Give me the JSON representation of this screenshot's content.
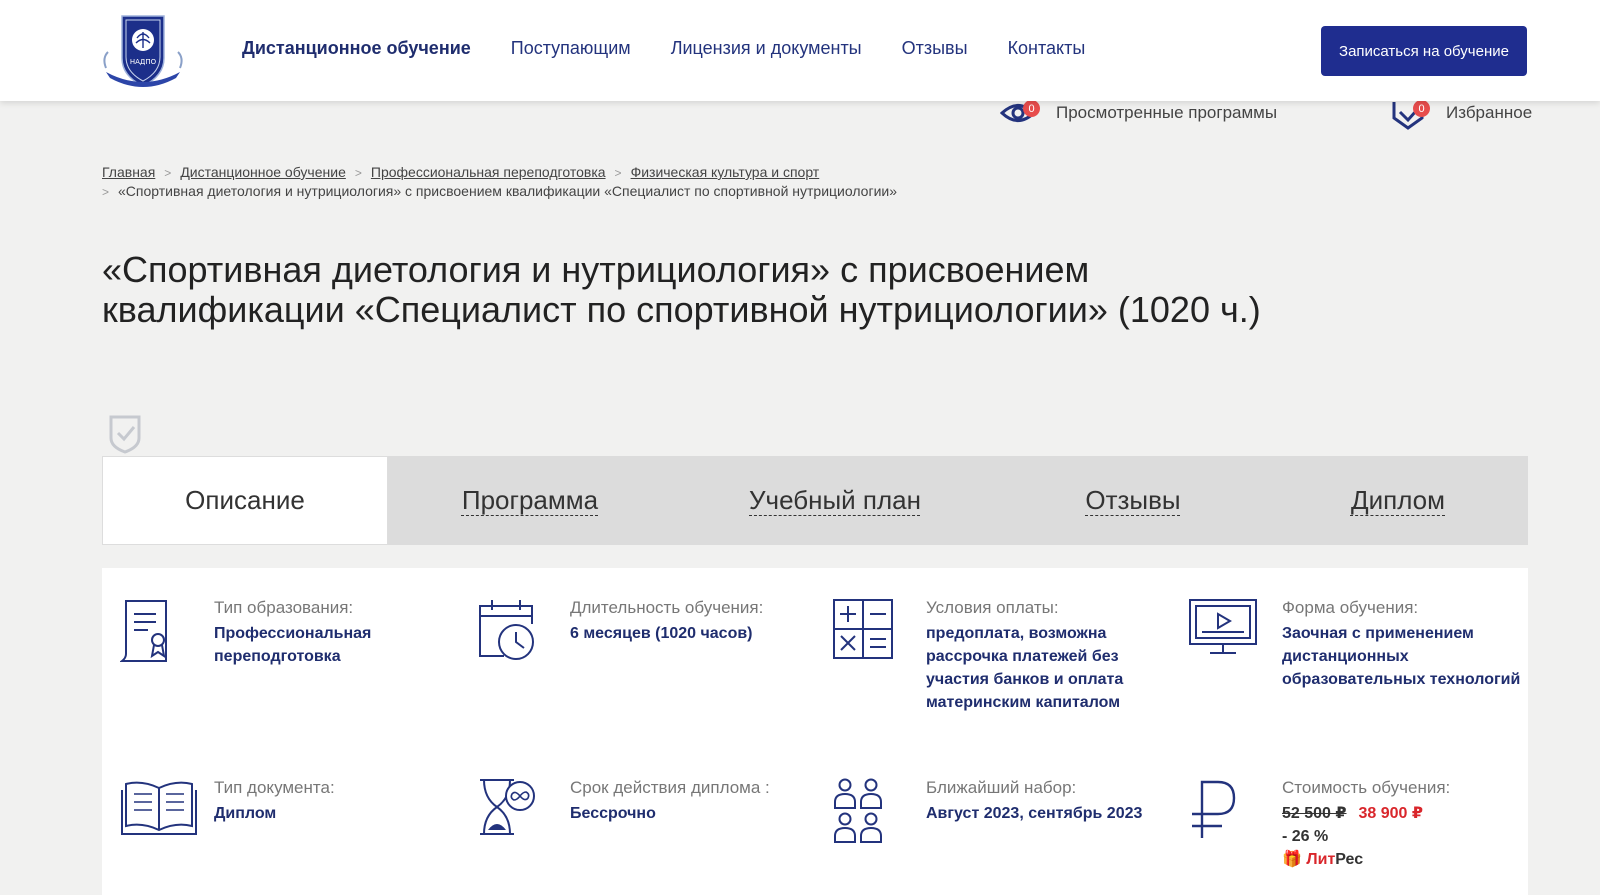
{
  "header": {
    "logo_text": "НАДПО",
    "nav": [
      {
        "label": "Дистанционное обучение",
        "active": true
      },
      {
        "label": "Поступающим",
        "active": false
      },
      {
        "label": "Лицензия и документы",
        "active": false
      },
      {
        "label": "Отзывы",
        "active": false
      },
      {
        "label": "Контакты",
        "active": false
      }
    ],
    "cta_label": "Записаться на обучение"
  },
  "utilities": {
    "viewed": {
      "label": "Просмотренные программы",
      "count": "0",
      "icon": "eye-icon"
    },
    "favorites": {
      "label": "Избранное",
      "count": "0",
      "icon": "heart-check-icon"
    }
  },
  "breadcrumb": {
    "items": [
      "Главная",
      "Дистанционное обучение",
      "Профессиональная переподготовка",
      "Физическая культура и спорт"
    ],
    "current": "«Спортивная диетология и нутрициология» с присвоением квалификации «Специалист по спортивной нутрициологии»"
  },
  "page_title": "«Спортивная диетология и нутрициология» с присвоением квалификации «Специалист по спортивной нутрициологии» (1020 ч.)",
  "tabs": [
    {
      "label": "Описание",
      "active": true
    },
    {
      "label": "Программа",
      "active": false
    },
    {
      "label": "Учебный план",
      "active": false
    },
    {
      "label": "Отзывы",
      "active": false
    },
    {
      "label": "Диплом",
      "active": false
    }
  ],
  "info": {
    "edu_type": {
      "label": "Тип образования:",
      "value": "Профессиональная переподготовка",
      "icon": "document-award-icon"
    },
    "duration": {
      "label": "Длительность обучения:",
      "value": "6 месяцев (1020 часов)",
      "icon": "calendar-clock-icon"
    },
    "payment": {
      "label": "Условия оплаты:",
      "value": "предоплата, возможна рассрочка платежей без участия банков и оплата материнским капиталом",
      "icon": "calculator-icon"
    },
    "form": {
      "label": "Форма обучения:",
      "value": "Заочная с применением дистанционных образовательных технологий",
      "icon": "monitor-play-icon"
    },
    "doc_type": {
      "label": "Тип документа:",
      "value": "Диплом",
      "icon": "open-book-icon"
    },
    "validity": {
      "label": "Срок действия диплома :",
      "value": "Бессрочно",
      "icon": "hourglass-infinity-icon"
    },
    "next_intake": {
      "label": "Ближайший набор:",
      "value": "Август 2023, сентябрь 2023",
      "icon": "people-group-icon"
    },
    "cost": {
      "label": "Стоимость обучения:",
      "old_price": "52 500 ₽",
      "new_price": "38 900 ₽",
      "discount": "- 26 %",
      "partner_prefix": "Лит",
      "partner_suffix": "Рес",
      "icon": "ruble-icon"
    }
  }
}
